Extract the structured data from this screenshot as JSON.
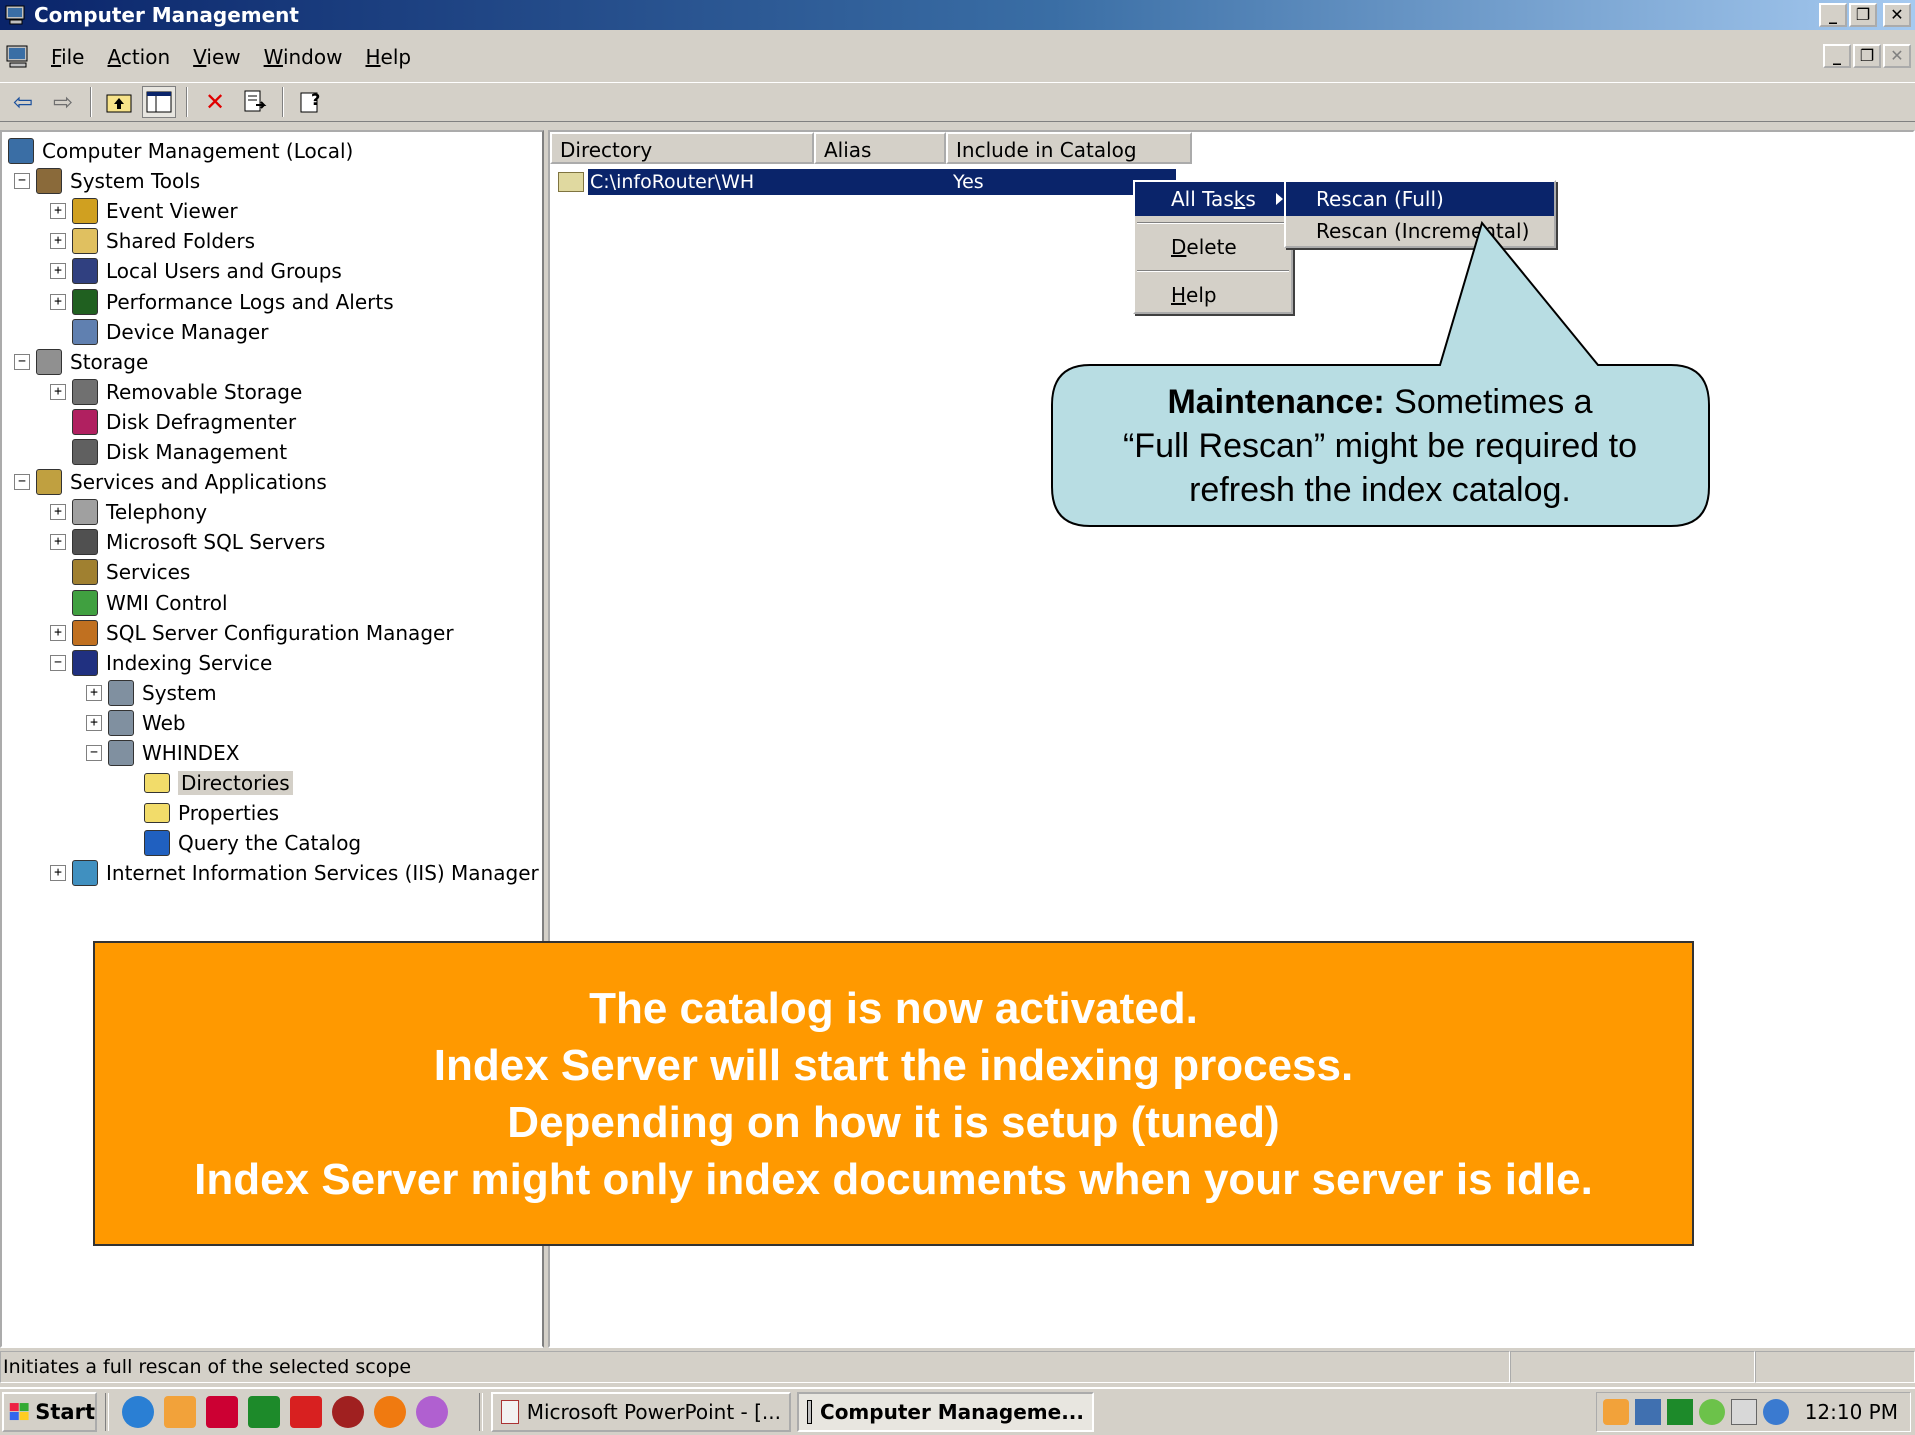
{
  "window": {
    "title": "Computer Management"
  },
  "menu": [
    "File",
    "Action",
    "View",
    "Window",
    "Help"
  ],
  "menu_accel": [
    "F",
    "A",
    "V",
    "W",
    "H"
  ],
  "tree": {
    "items": [
      {
        "label": "Computer Management (Local)",
        "icon": "computer-icon"
      },
      {
        "label": "System Tools",
        "icon": "tools-icon",
        "expander": "−"
      },
      {
        "label": "Event Viewer",
        "icon": "event-viewer-icon",
        "expander": "+"
      },
      {
        "label": "Shared Folders",
        "icon": "shared-folder-icon",
        "expander": "+"
      },
      {
        "label": "Local Users and Groups",
        "icon": "users-icon",
        "expander": "+"
      },
      {
        "label": "Performance Logs and Alerts",
        "icon": "performance-icon",
        "expander": "+"
      },
      {
        "label": "Device Manager",
        "icon": "device-manager-icon"
      },
      {
        "label": "Storage",
        "icon": "storage-icon",
        "expander": "−"
      },
      {
        "label": "Removable Storage",
        "icon": "removable-storage-icon",
        "expander": "+"
      },
      {
        "label": "Disk Defragmenter",
        "icon": "defrag-icon"
      },
      {
        "label": "Disk Management",
        "icon": "disk-management-icon"
      },
      {
        "label": "Services and Applications",
        "icon": "services-apps-icon",
        "expander": "−"
      },
      {
        "label": "Telephony",
        "icon": "telephony-icon",
        "expander": "+"
      },
      {
        "label": "Microsoft SQL Servers",
        "icon": "sql-servers-icon",
        "expander": "+"
      },
      {
        "label": "Services",
        "icon": "services-icon"
      },
      {
        "label": "WMI Control",
        "icon": "wmi-icon"
      },
      {
        "label": "SQL Server Configuration Manager",
        "icon": "sql-config-icon",
        "expander": "+"
      },
      {
        "label": "Indexing Service",
        "icon": "indexing-icon",
        "expander": "−"
      },
      {
        "label": "System",
        "icon": "catalog-icon",
        "expander": "+"
      },
      {
        "label": "Web",
        "icon": "catalog-icon",
        "expander": "+"
      },
      {
        "label": "WHINDEX",
        "icon": "catalog-icon",
        "expander": "−"
      },
      {
        "label": "Directories",
        "icon": "folder-icon",
        "selected": true
      },
      {
        "label": "Properties",
        "icon": "folder-icon"
      },
      {
        "label": "Query the Catalog",
        "icon": "query-icon"
      },
      {
        "label": "Internet Information Services (IIS) Manager",
        "icon": "iis-icon",
        "expander": "+"
      }
    ]
  },
  "list": {
    "columns": [
      "Directory",
      "Alias",
      "Include in Catalog"
    ],
    "rows": [
      {
        "directory": "C:\\infoRouter\\WH",
        "alias": "",
        "include": "Yes"
      }
    ]
  },
  "context_menu": {
    "items": [
      "All Tasks",
      "Delete",
      "Help"
    ],
    "accel": [
      "k",
      "D",
      "H"
    ],
    "submenu": [
      "Rescan (Full)",
      "Rescan (Incremental)"
    ]
  },
  "callout": {
    "bold": "Maintenance:",
    "line1_rest": " Sometimes a",
    "line2": "“Full Rescan” might be required to",
    "line3": "refresh the index catalog."
  },
  "banner": {
    "lines": [
      "The catalog is now activated.",
      "Index Server will start the indexing process.",
      "Depending on how it is setup (tuned)",
      "Index Server might only index documents when your server is idle."
    ]
  },
  "status": {
    "text": "Initiates a full rescan of the selected scope"
  },
  "taskbar": {
    "start": "Start",
    "tasks": [
      {
        "label": "Microsoft PowerPoint - [...",
        "icon": "powerpoint-icon"
      },
      {
        "label": "Computer Manageme...",
        "icon": "computer-management-icon",
        "active": true
      }
    ],
    "clock": "12:10 PM"
  },
  "colors": {
    "title_active": "#0a246a",
    "selection": "#0a246a",
    "callout_fill": "#b8dde3",
    "banner_fill": "#ff9900"
  }
}
